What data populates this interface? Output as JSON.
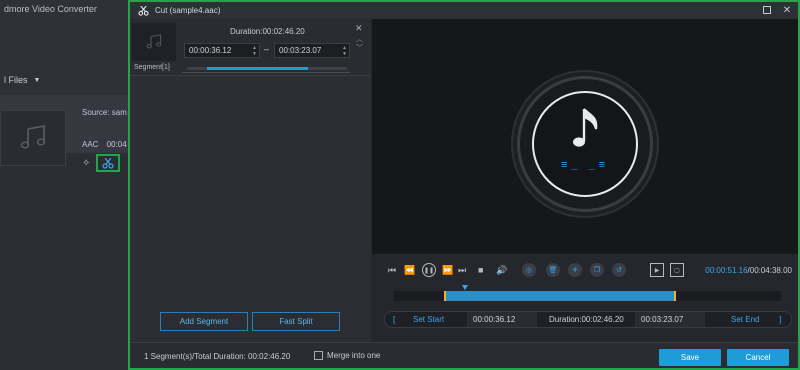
{
  "background_app": {
    "title": "dmore Video Converter",
    "toolbar_label": "l Files",
    "source_label": "Source: sam",
    "meta_label": "AAC",
    "meta_time": "00:04"
  },
  "dialog": {
    "title": "Cut (sample4.aac)",
    "segment": {
      "label": "Segment[1]",
      "duration": "Duration:00:02:46.20",
      "start_time": "00:00:36.12",
      "end_time": "00:03:23.07",
      "dash": "–"
    },
    "add_segment_label": "Add Segment",
    "fast_split_label": "Fast Split",
    "time_readout": {
      "current": "00:00:51.16",
      "total": "/00:04:38.00"
    },
    "set_bar": {
      "left_bracket": "[",
      "set_start": "Set Start",
      "start_time": "00:00:36.12",
      "duration": "Duration:00:02:46.20",
      "end_time": "00:03:23.07",
      "set_end": "Set End",
      "right_bracket": "]"
    },
    "footer": {
      "summary": "1 Segment(s)/Total Duration: 00:02:46.20",
      "merge_label": "Merge into one",
      "save_label": "Save",
      "cancel_label": "Cancel"
    },
    "selection": {
      "start_fraction": 0.13,
      "end_fraction": 0.73,
      "playhead_fraction": 0.184
    },
    "segment_progress_fraction": 0.63,
    "colors": {
      "accent": "#1f9bd8",
      "highlight_border": "#1fa84a",
      "handle": "#e8b42e"
    }
  }
}
